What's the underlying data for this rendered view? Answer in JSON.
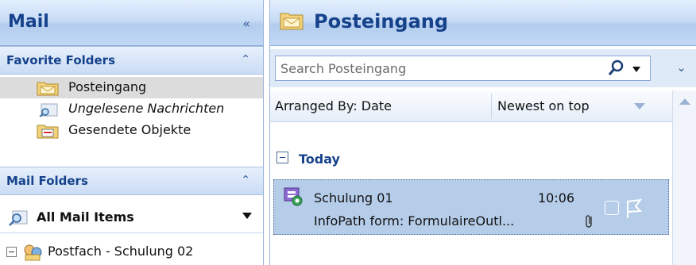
{
  "nav": {
    "title": "Mail",
    "collapse_glyph": "«",
    "favorites": {
      "title": "Favorite Folders",
      "toggle_glyph": "⌃",
      "items": [
        {
          "label": "Posteingang",
          "icon": "inbox-folder-icon",
          "selected": true
        },
        {
          "label": "Ungelesene Nachrichten",
          "icon": "search-folder-icon",
          "italic": true
        },
        {
          "label": "Gesendete Objekte",
          "icon": "sent-items-folder-icon"
        }
      ]
    },
    "mail_folders": {
      "title": "Mail Folders",
      "toggle_glyph": "⌃",
      "all_items_label": "All Mail Items",
      "mailbox_label": "Postfach - Schulung 02"
    }
  },
  "main": {
    "title": "Posteingang",
    "search_placeholder": "Search Posteingang",
    "expand_glyph": "⌄",
    "arranged_by": "Arranged By: Date",
    "sort_order": "Newest on top",
    "group_label": "Today",
    "message": {
      "sender": "Schulung 01",
      "time": "10:06",
      "subject": "InfoPath form: FormulaireOutl..."
    }
  },
  "colors": {
    "header_text": "#15428b",
    "selected_row": "#b6cde9",
    "pane_border": "#9ab3d5"
  }
}
